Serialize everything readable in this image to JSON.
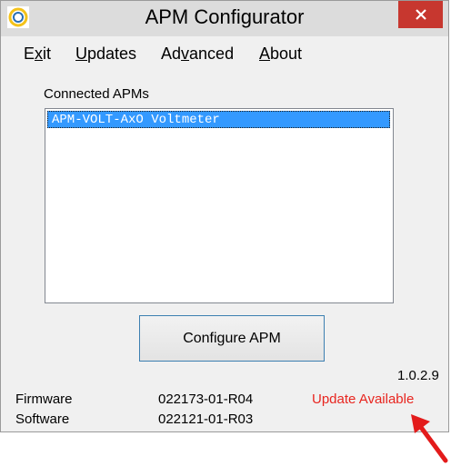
{
  "window": {
    "title": "APM Configurator",
    "close_glyph": "✕"
  },
  "menu": {
    "exit": {
      "pre": "E",
      "ul": "x",
      "post": "it"
    },
    "updates": {
      "pre": "",
      "ul": "U",
      "post": "pdates"
    },
    "advanced": {
      "pre": "Ad",
      "ul": "v",
      "post": "anced"
    },
    "about": {
      "pre": "",
      "ul": "A",
      "post": "bout"
    }
  },
  "apm_list": {
    "label": "Connected APMs",
    "items": [
      "APM-VOLT-AxO Voltmeter"
    ],
    "selected_index": 0
  },
  "configure_button": "Configure APM",
  "version": "1.0.2.9",
  "firmware": {
    "label": "Firmware",
    "value": "022173-01-R04"
  },
  "software": {
    "label": "Software",
    "value": "022121-01-R03"
  },
  "update_status": "Update Available",
  "colors": {
    "close_button": "#c7372f",
    "selection": "#3399ff",
    "update_text": "#e8251f",
    "arrow": "#e31b1b"
  },
  "icons": [
    "app-logo-icon",
    "close-icon",
    "red-arrow-icon"
  ]
}
